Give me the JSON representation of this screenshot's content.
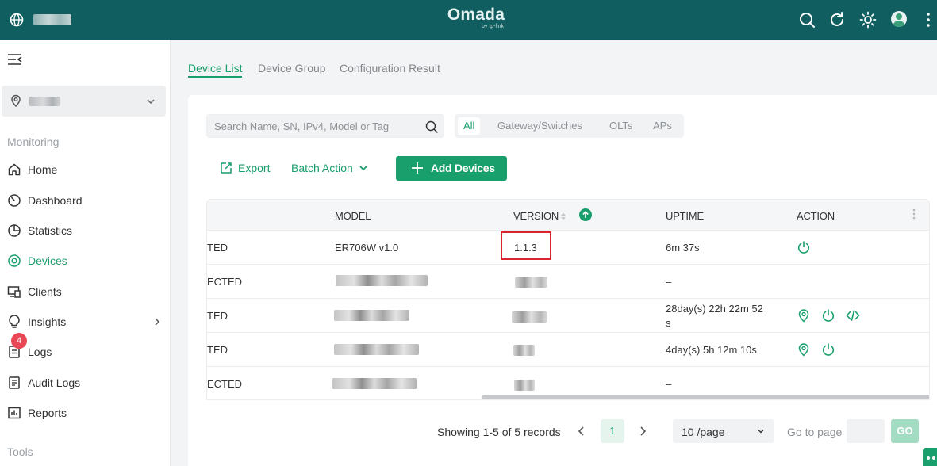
{
  "colors": {
    "header_bg": "#105e5f",
    "accent": "#199f6b",
    "alert": "#e84855",
    "highlight": "#d9262e"
  },
  "header": {
    "brand": "Omada",
    "brand_sub": "by tp-link",
    "icons": [
      "globe-icon",
      "search-icon",
      "refresh-icon",
      "theme-sun-icon",
      "user-avatar",
      "more-vertical-icon"
    ]
  },
  "sidebar": {
    "sections": {
      "monitoring": "Monitoring",
      "tools": "Tools"
    },
    "items": [
      {
        "label": "Home",
        "icon": "home-icon"
      },
      {
        "label": "Dashboard",
        "icon": "gauge-icon"
      },
      {
        "label": "Statistics",
        "icon": "pie-chart-icon"
      },
      {
        "label": "Devices",
        "icon": "target-icon",
        "active": true
      },
      {
        "label": "Clients",
        "icon": "clients-icon"
      },
      {
        "label": "Insights",
        "icon": "lightbulb-icon"
      },
      {
        "label": "Logs",
        "icon": "logs-icon",
        "badge": "4"
      },
      {
        "label": "Audit Logs",
        "icon": "audit-icon"
      },
      {
        "label": "Reports",
        "icon": "report-icon"
      }
    ]
  },
  "tabs": [
    "Device List",
    "Device Group",
    "Configuration Result"
  ],
  "search": {
    "placeholder": "Search Name, SN, IPv4, Model or Tag"
  },
  "filters": [
    "All",
    "Gateway/Switches",
    "OLTs",
    "APs"
  ],
  "toolbar": {
    "export": "Export",
    "batch_action": "Batch Action",
    "add_devices": "Add Devices"
  },
  "table": {
    "columns": [
      "MODEL",
      "VERSION",
      "UPTIME",
      "ACTION"
    ],
    "rows": [
      {
        "status": "TED",
        "model": "ER706W v1.0",
        "version": "1.1.3",
        "uptime": "6m 37s",
        "actions": [
          "power-icon"
        ]
      },
      {
        "status": "ECTED",
        "model": "",
        "version": "",
        "uptime": "–",
        "actions": []
      },
      {
        "status": "TED",
        "model": "",
        "version": "",
        "uptime_line1": "28day(s) 22h 22m 52",
        "uptime_line2": "s",
        "actions": [
          "locate-icon",
          "power-icon",
          "cli-icon"
        ]
      },
      {
        "status": "TED",
        "model": "",
        "version": "",
        "uptime": "4day(s) 5h 12m 10s",
        "actions": [
          "locate-icon",
          "power-icon"
        ]
      },
      {
        "status": "ECTED",
        "model": "",
        "version": "",
        "uptime": "–",
        "actions": []
      }
    ]
  },
  "pagination": {
    "summary": "Showing 1-5 of 5 records",
    "current_page": "1",
    "per_page": "10 /page",
    "goto_label": "Go to page",
    "go": "GO"
  }
}
